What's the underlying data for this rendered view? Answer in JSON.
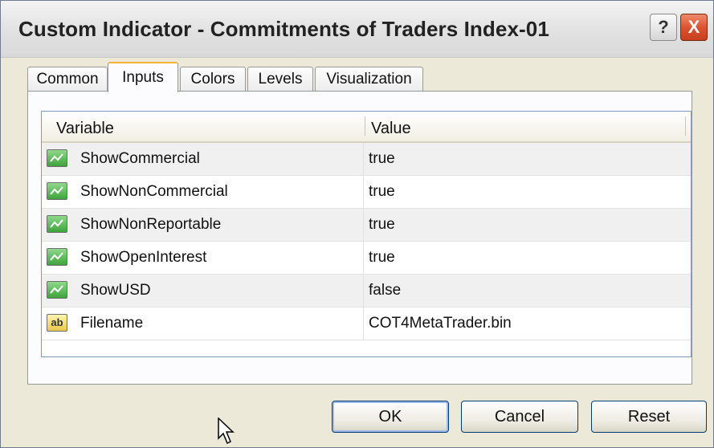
{
  "window": {
    "title": "Custom Indicator - Commitments of Traders Index-01",
    "help_label": "?",
    "close_label": "X"
  },
  "tabs": [
    {
      "label": "Common",
      "active": false
    },
    {
      "label": "Inputs",
      "active": true
    },
    {
      "label": "Colors",
      "active": false
    },
    {
      "label": "Levels",
      "active": false
    },
    {
      "label": "Visualization",
      "active": false
    }
  ],
  "grid": {
    "columns": [
      "Variable",
      "Value"
    ],
    "rows": [
      {
        "type_icon": "bool-icon",
        "variable": "ShowCommercial",
        "value": "true"
      },
      {
        "type_icon": "bool-icon",
        "variable": "ShowNonCommercial",
        "value": "true"
      },
      {
        "type_icon": "bool-icon",
        "variable": "ShowNonReportable",
        "value": "true"
      },
      {
        "type_icon": "bool-icon",
        "variable": "ShowOpenInterest",
        "value": "true"
      },
      {
        "type_icon": "bool-icon",
        "variable": "ShowUSD",
        "value": "false"
      },
      {
        "type_icon": "string-icon",
        "icon_text": "ab",
        "variable": "Filename",
        "value": "COT4MetaTrader.bin"
      }
    ]
  },
  "buttons": {
    "ok": "OK",
    "cancel": "Cancel",
    "reset": "Reset"
  },
  "colors": {
    "active_tab_accent": "#f7b23a",
    "close_button": "#d9512c",
    "grid_border": "#7f9db9"
  }
}
